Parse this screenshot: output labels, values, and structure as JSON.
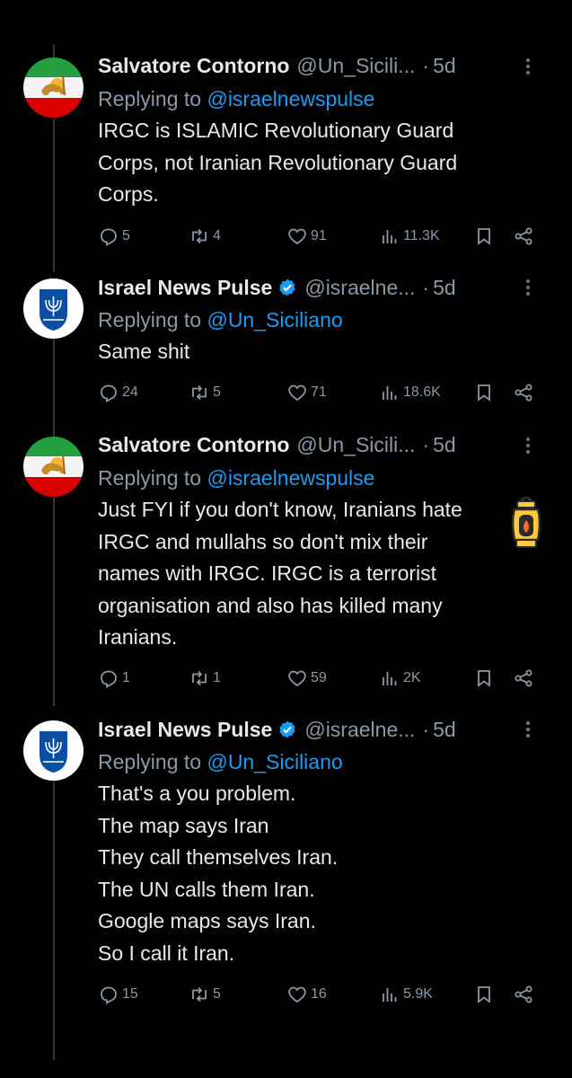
{
  "tweets": [
    {
      "name": "Salvatore Contorno",
      "handle": "@Un_Sicili...",
      "time": "5d",
      "verified": false,
      "avatar": "iran-lion-sun-flag-avatar",
      "replying_prefix": "Replying to ",
      "replying_to": "@israelnewspulse",
      "lines": [
        "IRGC is ISLAMIC Revolutionary Guard",
        "Corps, not Iranian Revolutionary Guard",
        "Corps."
      ],
      "replies": "5",
      "retweets": "4",
      "likes": "91",
      "views": "11.3K"
    },
    {
      "name": "Israel News Pulse",
      "handle": "@israelne...",
      "time": "5d",
      "verified": true,
      "avatar": "israel-emblem-avatar",
      "replying_prefix": "Replying to ",
      "replying_to": "@Un_Siciliano",
      "lines": [
        "Same shit"
      ],
      "replies": "24",
      "retweets": "5",
      "likes": "71",
      "views": "18.6K"
    },
    {
      "name": "Salvatore Contorno",
      "handle": "@Un_Sicili...",
      "time": "5d",
      "verified": false,
      "avatar": "iran-lion-sun-flag-avatar",
      "replying_prefix": "Replying to ",
      "replying_to": "@israelnewspulse",
      "lines": [
        "Just FYI if you don't know, Iranians hate",
        "IRGC and mullahs so don't mix their",
        "names with IRGC. IRGC is a terrorist",
        "organisation and also has killed many",
        "Iranians."
      ],
      "replies": "1",
      "retweets": "1",
      "likes": "59",
      "views": "2K"
    },
    {
      "name": "Israel News Pulse",
      "handle": "@israelne...",
      "time": "5d",
      "verified": true,
      "avatar": "israel-emblem-avatar",
      "replying_prefix": "Replying to ",
      "replying_to": "@Un_Siciliano",
      "lines": [
        "That's a you problem.",
        "The map says Iran",
        "They call themselves Iran.",
        "The UN calls them Iran.",
        "Google maps says Iran.",
        "So I call it Iran."
      ],
      "replies": "15",
      "retweets": "5",
      "likes": "16",
      "views": "5.9K"
    }
  ],
  "icons": {
    "reply": "reply-icon",
    "retweet": "retweet-icon",
    "like": "heart-icon",
    "views": "views-icon",
    "bookmark": "bookmark-icon",
    "share": "share-icon",
    "more": "more-icon",
    "verified": "verified-badge-icon",
    "overlay": "lantern-emoji-icon"
  },
  "colors": {
    "background": "#000000",
    "text": "#e7e9ea",
    "secondary": "#8b98a5",
    "link": "#1d9bf0",
    "verified": "#1d9bf0"
  }
}
